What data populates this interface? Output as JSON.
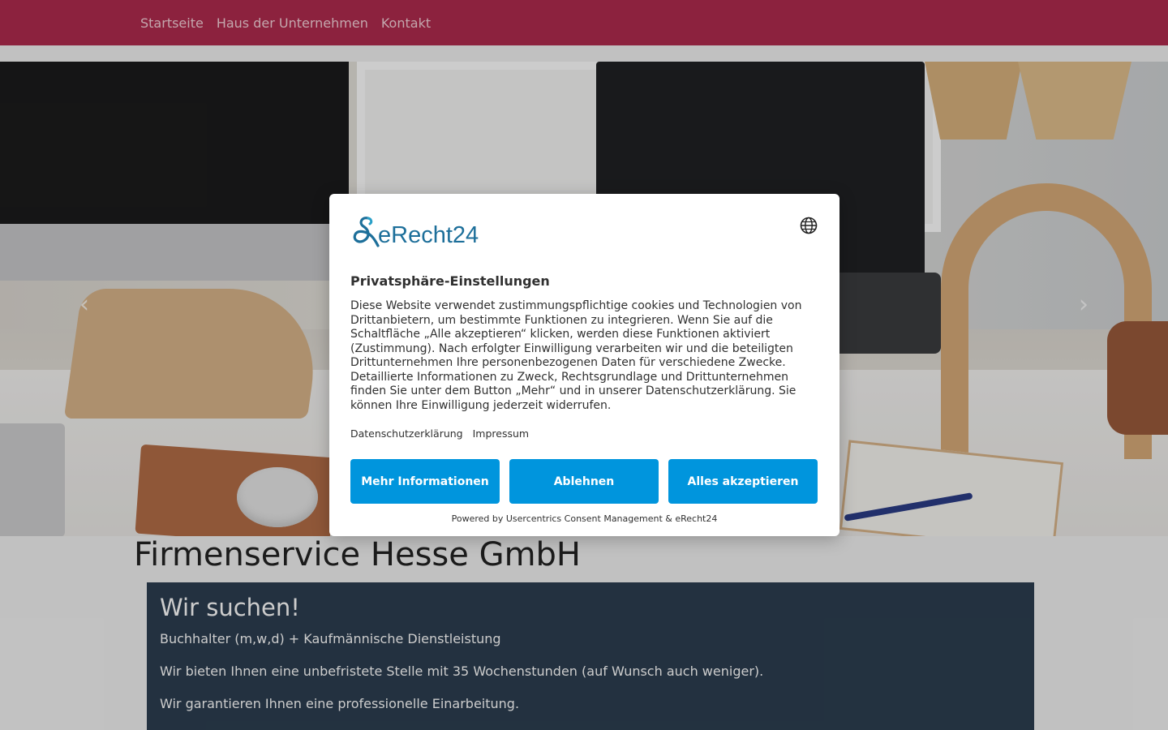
{
  "nav": {
    "items": [
      {
        "label": "Startseite"
      },
      {
        "label": "Haus der Unternehmen"
      },
      {
        "label": "Kontakt"
      }
    ]
  },
  "hero": {
    "prev_icon": "chevron-left-icon",
    "next_icon": "chevron-right-icon",
    "prev_glyph": "‹",
    "next_glyph": "›"
  },
  "main": {
    "company_name": "Firmenservice Hesse GmbH",
    "job": {
      "heading": "Wir suchen!",
      "lines": [
        "Buchhalter (m,w,d) + Kaufmännische Dienstleistung",
        "Wir bieten Ihnen eine unbefristete Stelle mit 35 Wochenstunden (auf Wunsch auch weniger).",
        "Wir garantieren Ihnen eine professionelle Einarbeitung."
      ]
    }
  },
  "consent": {
    "logo_text": "eRecht24",
    "language_icon": "globe-icon",
    "title": "Privatsphäre-Einstellungen",
    "body": "Diese Website verwendet zustimmungspflichtige cookies und Technologien von Drittanbietern, um bestimmte Funktionen zu integrieren. Wenn Sie auf die Schaltfläche „Alle akzeptieren“ klicken, werden diese Funktionen aktiviert (Zustimmung). Nach erfolgter Einwilligung verarbeiten wir und die beteiligten Drittunternehmen Ihre personenbezogenen Daten für verschiedene Zwecke. Detaillierte Informationen zu Zweck, Rechtsgrundlage und Drittunternehmen finden Sie unter dem Button „Mehr“ und in unserer Datenschutzerklärung. Sie können Ihre Einwilligung jederzeit widerrufen.",
    "links": {
      "privacy": "Datenschutzerklärung",
      "imprint": "Impressum"
    },
    "buttons": {
      "more": "Mehr Informationen",
      "decline": "Ablehnen",
      "accept": "Alles akzeptieren"
    },
    "powered_by": "Powered by Usercentrics Consent Management & eRecht24"
  },
  "colors": {
    "nav_bg": "#b02b4e",
    "button_bg": "#0095dd",
    "job_box_bg": "#2c3e50",
    "logo_color": "#1d6f9a"
  }
}
